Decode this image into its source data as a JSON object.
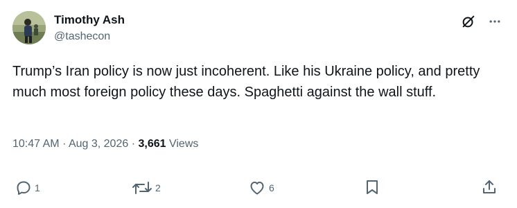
{
  "author": {
    "display_name": "Timothy Ash",
    "handle": "@tashecon",
    "avatar_icon": "profile-photo"
  },
  "tweet": {
    "text": "Trump’s Iran policy is now just incoherent. Like his Ukraine policy, and pretty much most foreign policy these days. Spaghetti against the wall stuff."
  },
  "meta": {
    "time": "10:47 AM",
    "separator": "·",
    "date": "Aug 3, 2026",
    "views_count": "3,661",
    "views_label": "Views"
  },
  "actions": {
    "reply_count": "1",
    "repost_count": "2",
    "like_count": "6"
  },
  "icons": {
    "grok": "grok-icon",
    "more": "more-options-icon",
    "reply": "reply-icon",
    "repost": "repost-icon",
    "like": "like-icon",
    "bookmark": "bookmark-icon",
    "share": "share-icon"
  },
  "colors": {
    "text_primary": "#0f1419",
    "text_secondary": "#536471",
    "background": "#ffffff"
  }
}
